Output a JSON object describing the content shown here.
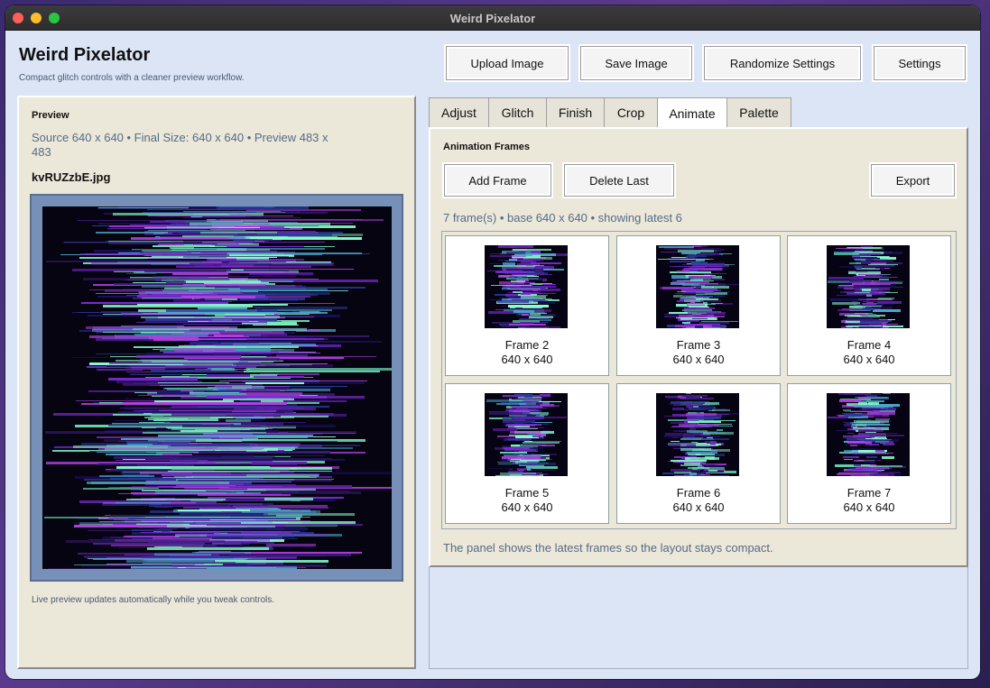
{
  "window": {
    "title": "Weird Pixelator"
  },
  "header": {
    "title": "Weird Pixelator",
    "subtitle": "Compact glitch controls with a cleaner preview workflow."
  },
  "toolbar": {
    "upload_label": "Upload Image",
    "save_label": "Save Image",
    "randomize_label": "Randomize Settings",
    "settings_label": "Settings"
  },
  "preview": {
    "heading": "Preview",
    "info": "Source 640 x 640 • Final Size: 640 x 640 • Preview 483 x 483",
    "filename": "kvRUZzbE.jpg",
    "note": "Live preview updates automatically while you tweak controls."
  },
  "tabs": [
    "Adjust",
    "Glitch",
    "Finish",
    "Crop",
    "Animate",
    "Palette"
  ],
  "active_tab": "Animate",
  "animate": {
    "heading": "Animation Frames",
    "add_label": "Add Frame",
    "delete_label": "Delete Last",
    "export_label": "Export",
    "status": "7 frame(s) • base 640 x 640 • showing latest 6",
    "note": "The panel shows the latest frames so the layout stays compact.",
    "frames": [
      {
        "name": "Frame 2",
        "size": "640 x 640"
      },
      {
        "name": "Frame 3",
        "size": "640 x 640"
      },
      {
        "name": "Frame 4",
        "size": "640 x 640"
      },
      {
        "name": "Frame 5",
        "size": "640 x 640"
      },
      {
        "name": "Frame 6",
        "size": "640 x 640"
      },
      {
        "name": "Frame 7",
        "size": "640 x 640"
      }
    ]
  },
  "colors": {
    "window_bg": "#dbe5f5",
    "panel_bg": "#ebe8da",
    "muted_text": "#566a86",
    "preview_border": "#7690b8"
  }
}
